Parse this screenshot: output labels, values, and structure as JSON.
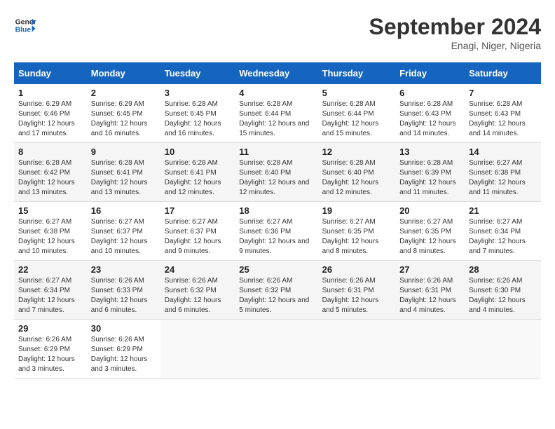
{
  "header": {
    "logo_line1": "General",
    "logo_line2": "Blue",
    "month": "September 2024",
    "location": "Enagi, Niger, Nigeria"
  },
  "days_of_week": [
    "Sunday",
    "Monday",
    "Tuesday",
    "Wednesday",
    "Thursday",
    "Friday",
    "Saturday"
  ],
  "weeks": [
    [
      {
        "day": "1",
        "sunrise": "6:29 AM",
        "sunset": "6:46 PM",
        "daylight": "12 hours and 17 minutes."
      },
      {
        "day": "2",
        "sunrise": "6:29 AM",
        "sunset": "6:45 PM",
        "daylight": "12 hours and 16 minutes."
      },
      {
        "day": "3",
        "sunrise": "6:28 AM",
        "sunset": "6:45 PM",
        "daylight": "12 hours and 16 minutes."
      },
      {
        "day": "4",
        "sunrise": "6:28 AM",
        "sunset": "6:44 PM",
        "daylight": "12 hours and 15 minutes."
      },
      {
        "day": "5",
        "sunrise": "6:28 AM",
        "sunset": "6:44 PM",
        "daylight": "12 hours and 15 minutes."
      },
      {
        "day": "6",
        "sunrise": "6:28 AM",
        "sunset": "6:43 PM",
        "daylight": "12 hours and 14 minutes."
      },
      {
        "day": "7",
        "sunrise": "6:28 AM",
        "sunset": "6:43 PM",
        "daylight": "12 hours and 14 minutes."
      }
    ],
    [
      {
        "day": "8",
        "sunrise": "6:28 AM",
        "sunset": "6:42 PM",
        "daylight": "12 hours and 13 minutes."
      },
      {
        "day": "9",
        "sunrise": "6:28 AM",
        "sunset": "6:41 PM",
        "daylight": "12 hours and 13 minutes."
      },
      {
        "day": "10",
        "sunrise": "6:28 AM",
        "sunset": "6:41 PM",
        "daylight": "12 hours and 12 minutes."
      },
      {
        "day": "11",
        "sunrise": "6:28 AM",
        "sunset": "6:40 PM",
        "daylight": "12 hours and 12 minutes."
      },
      {
        "day": "12",
        "sunrise": "6:28 AM",
        "sunset": "6:40 PM",
        "daylight": "12 hours and 12 minutes."
      },
      {
        "day": "13",
        "sunrise": "6:28 AM",
        "sunset": "6:39 PM",
        "daylight": "12 hours and 11 minutes."
      },
      {
        "day": "14",
        "sunrise": "6:27 AM",
        "sunset": "6:38 PM",
        "daylight": "12 hours and 11 minutes."
      }
    ],
    [
      {
        "day": "15",
        "sunrise": "6:27 AM",
        "sunset": "6:38 PM",
        "daylight": "12 hours and 10 minutes."
      },
      {
        "day": "16",
        "sunrise": "6:27 AM",
        "sunset": "6:37 PM",
        "daylight": "12 hours and 10 minutes."
      },
      {
        "day": "17",
        "sunrise": "6:27 AM",
        "sunset": "6:37 PM",
        "daylight": "12 hours and 9 minutes."
      },
      {
        "day": "18",
        "sunrise": "6:27 AM",
        "sunset": "6:36 PM",
        "daylight": "12 hours and 9 minutes."
      },
      {
        "day": "19",
        "sunrise": "6:27 AM",
        "sunset": "6:35 PM",
        "daylight": "12 hours and 8 minutes."
      },
      {
        "day": "20",
        "sunrise": "6:27 AM",
        "sunset": "6:35 PM",
        "daylight": "12 hours and 8 minutes."
      },
      {
        "day": "21",
        "sunrise": "6:27 AM",
        "sunset": "6:34 PM",
        "daylight": "12 hours and 7 minutes."
      }
    ],
    [
      {
        "day": "22",
        "sunrise": "6:27 AM",
        "sunset": "6:34 PM",
        "daylight": "12 hours and 7 minutes."
      },
      {
        "day": "23",
        "sunrise": "6:26 AM",
        "sunset": "6:33 PM",
        "daylight": "12 hours and 6 minutes."
      },
      {
        "day": "24",
        "sunrise": "6:26 AM",
        "sunset": "6:32 PM",
        "daylight": "12 hours and 6 minutes."
      },
      {
        "day": "25",
        "sunrise": "6:26 AM",
        "sunset": "6:32 PM",
        "daylight": "12 hours and 5 minutes."
      },
      {
        "day": "26",
        "sunrise": "6:26 AM",
        "sunset": "6:31 PM",
        "daylight": "12 hours and 5 minutes."
      },
      {
        "day": "27",
        "sunrise": "6:26 AM",
        "sunset": "6:31 PM",
        "daylight": "12 hours and 4 minutes."
      },
      {
        "day": "28",
        "sunrise": "6:26 AM",
        "sunset": "6:30 PM",
        "daylight": "12 hours and 4 minutes."
      }
    ],
    [
      {
        "day": "29",
        "sunrise": "6:26 AM",
        "sunset": "6:29 PM",
        "daylight": "12 hours and 3 minutes."
      },
      {
        "day": "30",
        "sunrise": "6:26 AM",
        "sunset": "6:29 PM",
        "daylight": "12 hours and 3 minutes."
      },
      null,
      null,
      null,
      null,
      null
    ]
  ]
}
